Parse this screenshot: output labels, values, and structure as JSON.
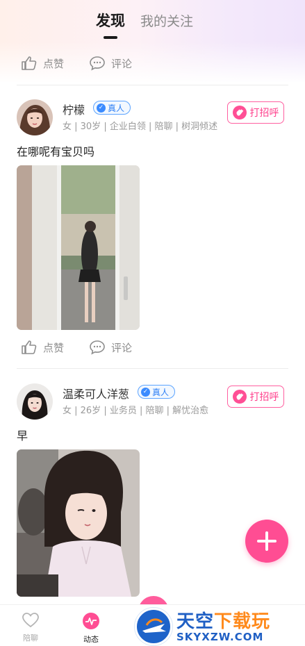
{
  "tabs": {
    "active": "发现",
    "inactive": "我的关注"
  },
  "top_actions": {
    "like": "点赞",
    "comment": "评论"
  },
  "posts": [
    {
      "name": "柠檬",
      "badge": "真人",
      "meta": "女 | 30岁 | 企业白领 | 陪聊 | 树洞倾述",
      "greet": "打招呼",
      "text": "在哪呢有宝贝吗",
      "like": "点赞",
      "comment": "评论"
    },
    {
      "name": "温柔可人洋葱",
      "badge": "真人",
      "meta": "女 | 26岁 | 业务员 | 陪聊 | 解忧治愈",
      "greet": "打招呼",
      "text": "早"
    }
  ],
  "tabbar": {
    "chat": "陪聊",
    "moments": "动态"
  },
  "watermark": {
    "brand_blue": "天空",
    "brand_orange": "下载玩",
    "url": "SKYXZW.COM"
  },
  "colors": {
    "accent": "#ff4d93",
    "badge_blue": "#3b8bff",
    "watermark_blue": "#1f5fc4"
  }
}
